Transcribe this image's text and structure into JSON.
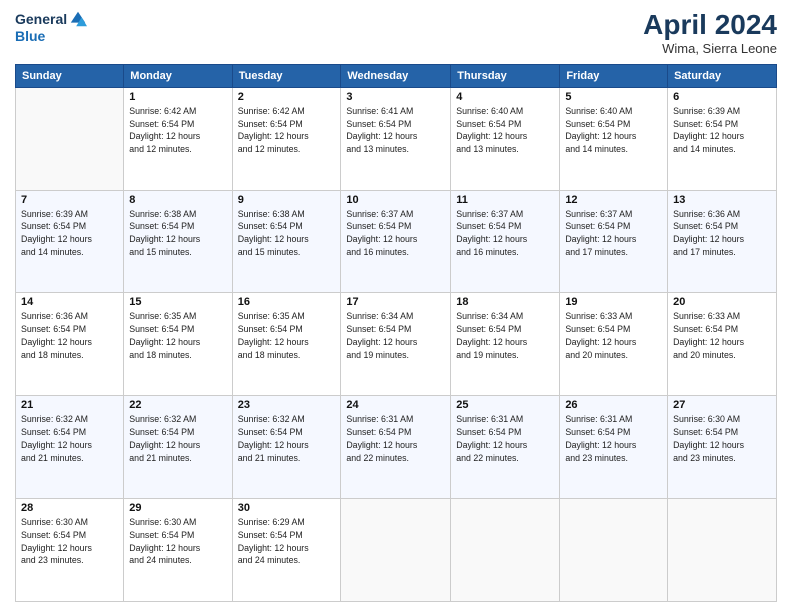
{
  "header": {
    "logo_general": "General",
    "logo_blue": "Blue",
    "month_title": "April 2024",
    "subtitle": "Wima, Sierra Leone"
  },
  "days_of_week": [
    "Sunday",
    "Monday",
    "Tuesday",
    "Wednesday",
    "Thursday",
    "Friday",
    "Saturday"
  ],
  "weeks": [
    [
      {
        "day": "",
        "info": ""
      },
      {
        "day": "1",
        "info": "Sunrise: 6:42 AM\nSunset: 6:54 PM\nDaylight: 12 hours\nand 12 minutes."
      },
      {
        "day": "2",
        "info": "Sunrise: 6:42 AM\nSunset: 6:54 PM\nDaylight: 12 hours\nand 12 minutes."
      },
      {
        "day": "3",
        "info": "Sunrise: 6:41 AM\nSunset: 6:54 PM\nDaylight: 12 hours\nand 13 minutes."
      },
      {
        "day": "4",
        "info": "Sunrise: 6:40 AM\nSunset: 6:54 PM\nDaylight: 12 hours\nand 13 minutes."
      },
      {
        "day": "5",
        "info": "Sunrise: 6:40 AM\nSunset: 6:54 PM\nDaylight: 12 hours\nand 14 minutes."
      },
      {
        "day": "6",
        "info": "Sunrise: 6:39 AM\nSunset: 6:54 PM\nDaylight: 12 hours\nand 14 minutes."
      }
    ],
    [
      {
        "day": "7",
        "info": "Sunrise: 6:39 AM\nSunset: 6:54 PM\nDaylight: 12 hours\nand 14 minutes."
      },
      {
        "day": "8",
        "info": "Sunrise: 6:38 AM\nSunset: 6:54 PM\nDaylight: 12 hours\nand 15 minutes."
      },
      {
        "day": "9",
        "info": "Sunrise: 6:38 AM\nSunset: 6:54 PM\nDaylight: 12 hours\nand 15 minutes."
      },
      {
        "day": "10",
        "info": "Sunrise: 6:37 AM\nSunset: 6:54 PM\nDaylight: 12 hours\nand 16 minutes."
      },
      {
        "day": "11",
        "info": "Sunrise: 6:37 AM\nSunset: 6:54 PM\nDaylight: 12 hours\nand 16 minutes."
      },
      {
        "day": "12",
        "info": "Sunrise: 6:37 AM\nSunset: 6:54 PM\nDaylight: 12 hours\nand 17 minutes."
      },
      {
        "day": "13",
        "info": "Sunrise: 6:36 AM\nSunset: 6:54 PM\nDaylight: 12 hours\nand 17 minutes."
      }
    ],
    [
      {
        "day": "14",
        "info": "Sunrise: 6:36 AM\nSunset: 6:54 PM\nDaylight: 12 hours\nand 18 minutes."
      },
      {
        "day": "15",
        "info": "Sunrise: 6:35 AM\nSunset: 6:54 PM\nDaylight: 12 hours\nand 18 minutes."
      },
      {
        "day": "16",
        "info": "Sunrise: 6:35 AM\nSunset: 6:54 PM\nDaylight: 12 hours\nand 18 minutes."
      },
      {
        "day": "17",
        "info": "Sunrise: 6:34 AM\nSunset: 6:54 PM\nDaylight: 12 hours\nand 19 minutes."
      },
      {
        "day": "18",
        "info": "Sunrise: 6:34 AM\nSunset: 6:54 PM\nDaylight: 12 hours\nand 19 minutes."
      },
      {
        "day": "19",
        "info": "Sunrise: 6:33 AM\nSunset: 6:54 PM\nDaylight: 12 hours\nand 20 minutes."
      },
      {
        "day": "20",
        "info": "Sunrise: 6:33 AM\nSunset: 6:54 PM\nDaylight: 12 hours\nand 20 minutes."
      }
    ],
    [
      {
        "day": "21",
        "info": "Sunrise: 6:32 AM\nSunset: 6:54 PM\nDaylight: 12 hours\nand 21 minutes."
      },
      {
        "day": "22",
        "info": "Sunrise: 6:32 AM\nSunset: 6:54 PM\nDaylight: 12 hours\nand 21 minutes."
      },
      {
        "day": "23",
        "info": "Sunrise: 6:32 AM\nSunset: 6:54 PM\nDaylight: 12 hours\nand 21 minutes."
      },
      {
        "day": "24",
        "info": "Sunrise: 6:31 AM\nSunset: 6:54 PM\nDaylight: 12 hours\nand 22 minutes."
      },
      {
        "day": "25",
        "info": "Sunrise: 6:31 AM\nSunset: 6:54 PM\nDaylight: 12 hours\nand 22 minutes."
      },
      {
        "day": "26",
        "info": "Sunrise: 6:31 AM\nSunset: 6:54 PM\nDaylight: 12 hours\nand 23 minutes."
      },
      {
        "day": "27",
        "info": "Sunrise: 6:30 AM\nSunset: 6:54 PM\nDaylight: 12 hours\nand 23 minutes."
      }
    ],
    [
      {
        "day": "28",
        "info": "Sunrise: 6:30 AM\nSunset: 6:54 PM\nDaylight: 12 hours\nand 23 minutes."
      },
      {
        "day": "29",
        "info": "Sunrise: 6:30 AM\nSunset: 6:54 PM\nDaylight: 12 hours\nand 24 minutes."
      },
      {
        "day": "30",
        "info": "Sunrise: 6:29 AM\nSunset: 6:54 PM\nDaylight: 12 hours\nand 24 minutes."
      },
      {
        "day": "",
        "info": ""
      },
      {
        "day": "",
        "info": ""
      },
      {
        "day": "",
        "info": ""
      },
      {
        "day": "",
        "info": ""
      }
    ]
  ]
}
